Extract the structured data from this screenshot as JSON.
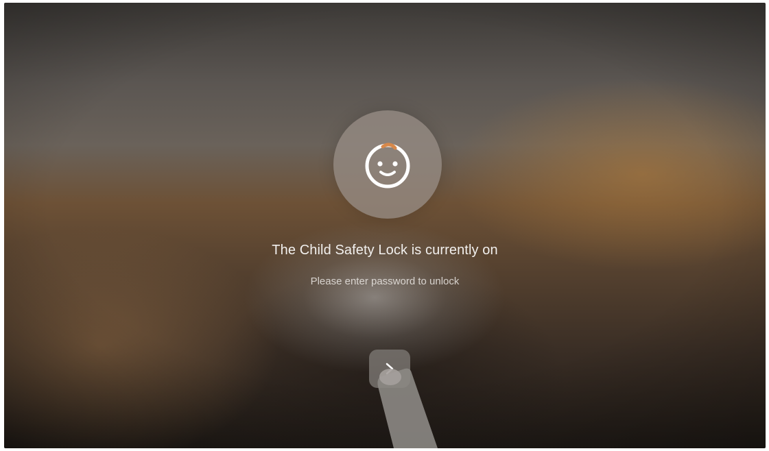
{
  "lock_screen": {
    "title": "The Child Safety Lock is currently on",
    "subtitle": "Please enter password to unlock",
    "avatar_icon": "child-face-icon",
    "next_icon": "chevron-right-icon"
  },
  "colors": {
    "avatar_bg": "#968c84",
    "accent_orange": "#d7884a",
    "text_primary": "#f2f0ee"
  }
}
